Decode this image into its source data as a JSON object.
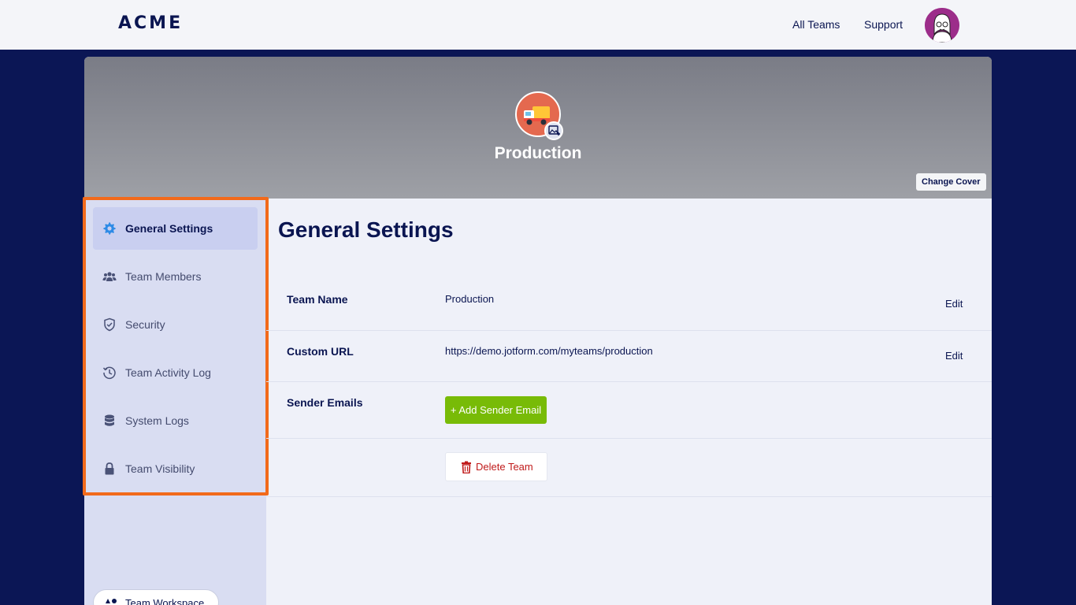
{
  "header": {
    "logo": "ACME",
    "nav": [
      "All Teams",
      "Support"
    ]
  },
  "team": {
    "name": "Production",
    "change_cover_label": "Change Cover"
  },
  "sidebar": {
    "items": [
      {
        "label": "General Settings",
        "icon": "gear-icon",
        "active": true
      },
      {
        "label": "Team Members",
        "icon": "users-icon",
        "active": false
      },
      {
        "label": "Security",
        "icon": "shield-icon",
        "active": false
      },
      {
        "label": "Team Activity Log",
        "icon": "history-icon",
        "active": false
      },
      {
        "label": "System Logs",
        "icon": "database-icon",
        "active": false
      },
      {
        "label": "Team Visibility",
        "icon": "lock-icon",
        "active": false
      }
    ],
    "workspace_label": "Team Workspace"
  },
  "main": {
    "title": "General Settings",
    "rows": [
      {
        "label": "Team Name",
        "value": "Production",
        "action": "Edit"
      },
      {
        "label": "Custom URL",
        "value": "https://demo.jotform.com/myteams/production",
        "action": "Edit"
      },
      {
        "label": "Sender Emails",
        "button": "+ Add Sender Email"
      }
    ],
    "delete_label": "Delete Team"
  },
  "colors": {
    "brand_navy": "#0a1551",
    "add_button": "#78bb07",
    "delete_text": "#c01a1a",
    "highlight": "#f26a1b"
  }
}
